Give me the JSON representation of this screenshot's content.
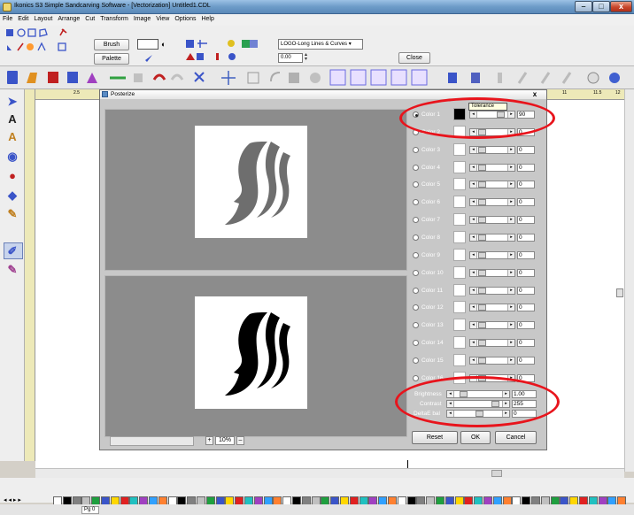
{
  "window": {
    "title": "Ikonics S3 Simple Sandcarving Software - [Vectorization] Untitled1.CDL",
    "minimize_glyph": "–",
    "maximize_glyph": "□",
    "close_glyph": "x"
  },
  "menu": [
    "File",
    "Edit",
    "Layout",
    "Arrange",
    "Cut",
    "Transform",
    "Image",
    "View",
    "Options",
    "Help"
  ],
  "toolbar": {
    "brush_label": "Brush",
    "palette_label": "Palette",
    "style_select": "LOGO-Long Lines & Curves",
    "angle_value": "0.00",
    "close_label": "Close"
  },
  "ruler": {
    "marks": [
      "2.5",
      "11",
      "11.5",
      "12"
    ]
  },
  "dialog": {
    "title": "Posterize",
    "close_glyph": "x",
    "tolerance_tooltip": "Tolerance",
    "colors": [
      {
        "label": "Color 1",
        "value": "90",
        "selected": true,
        "swatch": "#000000",
        "position": 0.82
      },
      {
        "label": "Color 2",
        "value": "0",
        "selected": false,
        "swatch": "#ffffff",
        "position": 0.0
      },
      {
        "label": "Color 3",
        "value": "0",
        "selected": false,
        "swatch": "#ffffff",
        "position": 0.0
      },
      {
        "label": "Color 4",
        "value": "0",
        "selected": false,
        "swatch": "#ffffff",
        "position": 0.0
      },
      {
        "label": "Color 5",
        "value": "0",
        "selected": false,
        "swatch": "#ffffff",
        "position": 0.0
      },
      {
        "label": "Color 6",
        "value": "0",
        "selected": false,
        "swatch": "#ffffff",
        "position": 0.0
      },
      {
        "label": "Color 7",
        "value": "0",
        "selected": false,
        "swatch": "#ffffff",
        "position": 0.0
      },
      {
        "label": "Color 8",
        "value": "0",
        "selected": false,
        "swatch": "#ffffff",
        "position": 0.0
      },
      {
        "label": "Color 9",
        "value": "0",
        "selected": false,
        "swatch": "#ffffff",
        "position": 0.0
      },
      {
        "label": "Color 10",
        "value": "0",
        "selected": false,
        "swatch": "#ffffff",
        "position": 0.0
      },
      {
        "label": "Color 11",
        "value": "0",
        "selected": false,
        "swatch": "#ffffff",
        "position": 0.0
      },
      {
        "label": "Color 12",
        "value": "0",
        "selected": false,
        "swatch": "#ffffff",
        "position": 0.0
      },
      {
        "label": "Color 13",
        "value": "0",
        "selected": false,
        "swatch": "#ffffff",
        "position": 0.0
      },
      {
        "label": "Color 14",
        "value": "0",
        "selected": false,
        "swatch": "#ffffff",
        "position": 0.0
      },
      {
        "label": "Color 15",
        "value": "0",
        "selected": false,
        "swatch": "#ffffff",
        "position": 0.0
      },
      {
        "label": "Color 16",
        "value": "0",
        "selected": false,
        "swatch": "#ffffff",
        "position": 0.0
      }
    ],
    "adjustments": [
      {
        "label": "Brightness",
        "value": "1.00",
        "position": 0.12
      },
      {
        "label": "Contrast",
        "value": "255",
        "position": 0.92
      },
      {
        "label": "DeltaE bal",
        "value": "0",
        "position": 0.5
      }
    ],
    "zoom": {
      "value": "10%",
      "plus": "+",
      "minus": "–"
    },
    "reset_label": "Reset",
    "ok_label": "OK",
    "cancel_label": "Cancel"
  },
  "status": {
    "page": "Pg 0"
  },
  "colors": {
    "annotation": "#e8141c",
    "preview_bg": "#8c8c8c",
    "silhouette_gray": "#6e6e6e"
  }
}
